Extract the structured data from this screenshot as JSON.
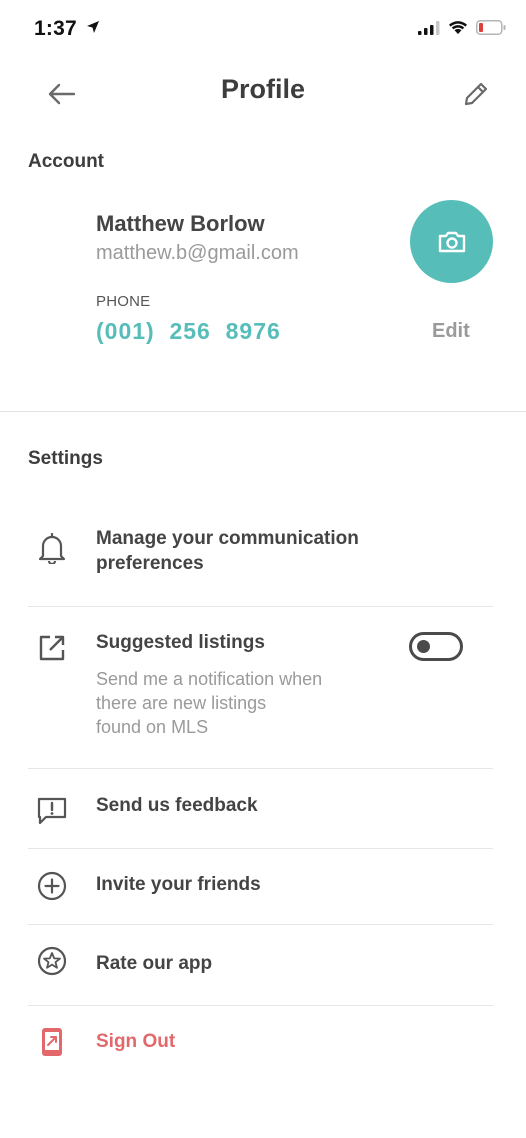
{
  "status_bar": {
    "time": "1:37"
  },
  "nav": {
    "title": "Profile"
  },
  "account": {
    "section_title": "Account",
    "name": "Matthew Borlow",
    "email": "matthew.b@gmail.com",
    "phone_label": "PHONE",
    "phone": "(001)  256  8976",
    "edit_label": "Edit"
  },
  "settings": {
    "section_title": "Settings",
    "items": [
      {
        "icon": "bell-icon",
        "label_line1": "Manage your communication",
        "label_line2": "preferences"
      },
      {
        "icon": "external-link-icon",
        "label": "Suggested listings",
        "sub_line1": "Send me a notification when",
        "sub_line2": "there are new listings",
        "sub_line3": "found on MLS",
        "toggle_on": false
      },
      {
        "icon": "feedback-icon",
        "label": "Send us feedback"
      },
      {
        "icon": "plus-circle-icon",
        "label": "Invite your friends"
      },
      {
        "icon": "star-circle-icon",
        "label": "Rate our app"
      },
      {
        "icon": "sign-out-icon",
        "label": "Sign Out"
      }
    ]
  },
  "colors": {
    "accent": "#56bdb9",
    "danger": "#e2686c",
    "text": "#3d3d3d",
    "muted": "#9a9a9a"
  }
}
